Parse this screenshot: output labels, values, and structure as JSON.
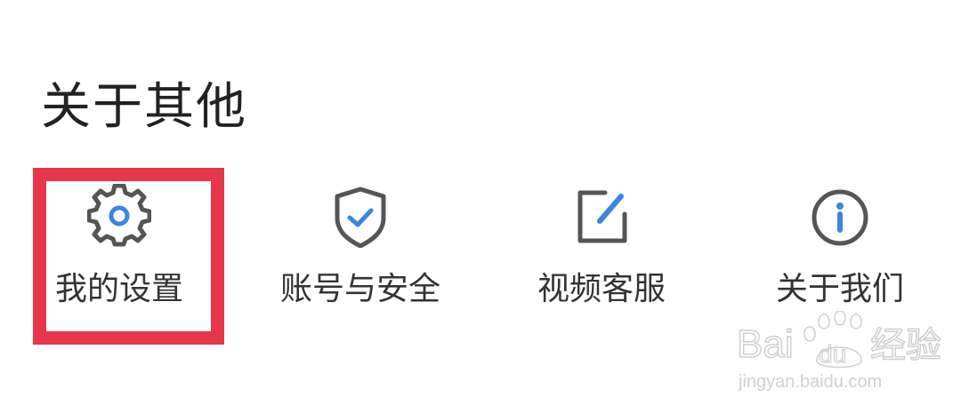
{
  "section": {
    "title": "关于其他"
  },
  "items": [
    {
      "label": "我的设置",
      "icon": "gear-icon"
    },
    {
      "label": "账号与安全",
      "icon": "shield-check-icon"
    },
    {
      "label": "视频客服",
      "icon": "edit-icon"
    },
    {
      "label": "关于我们",
      "icon": "info-icon"
    }
  ],
  "colors": {
    "icon_stroke": "#555555",
    "icon_accent": "#3a86e0",
    "label_text": "#333333",
    "highlight": "#e5364a",
    "watermark": "#d5d5d5"
  },
  "watermark": {
    "logo_text": "Baidu 经验",
    "url": "jingyan.baidu.com"
  }
}
